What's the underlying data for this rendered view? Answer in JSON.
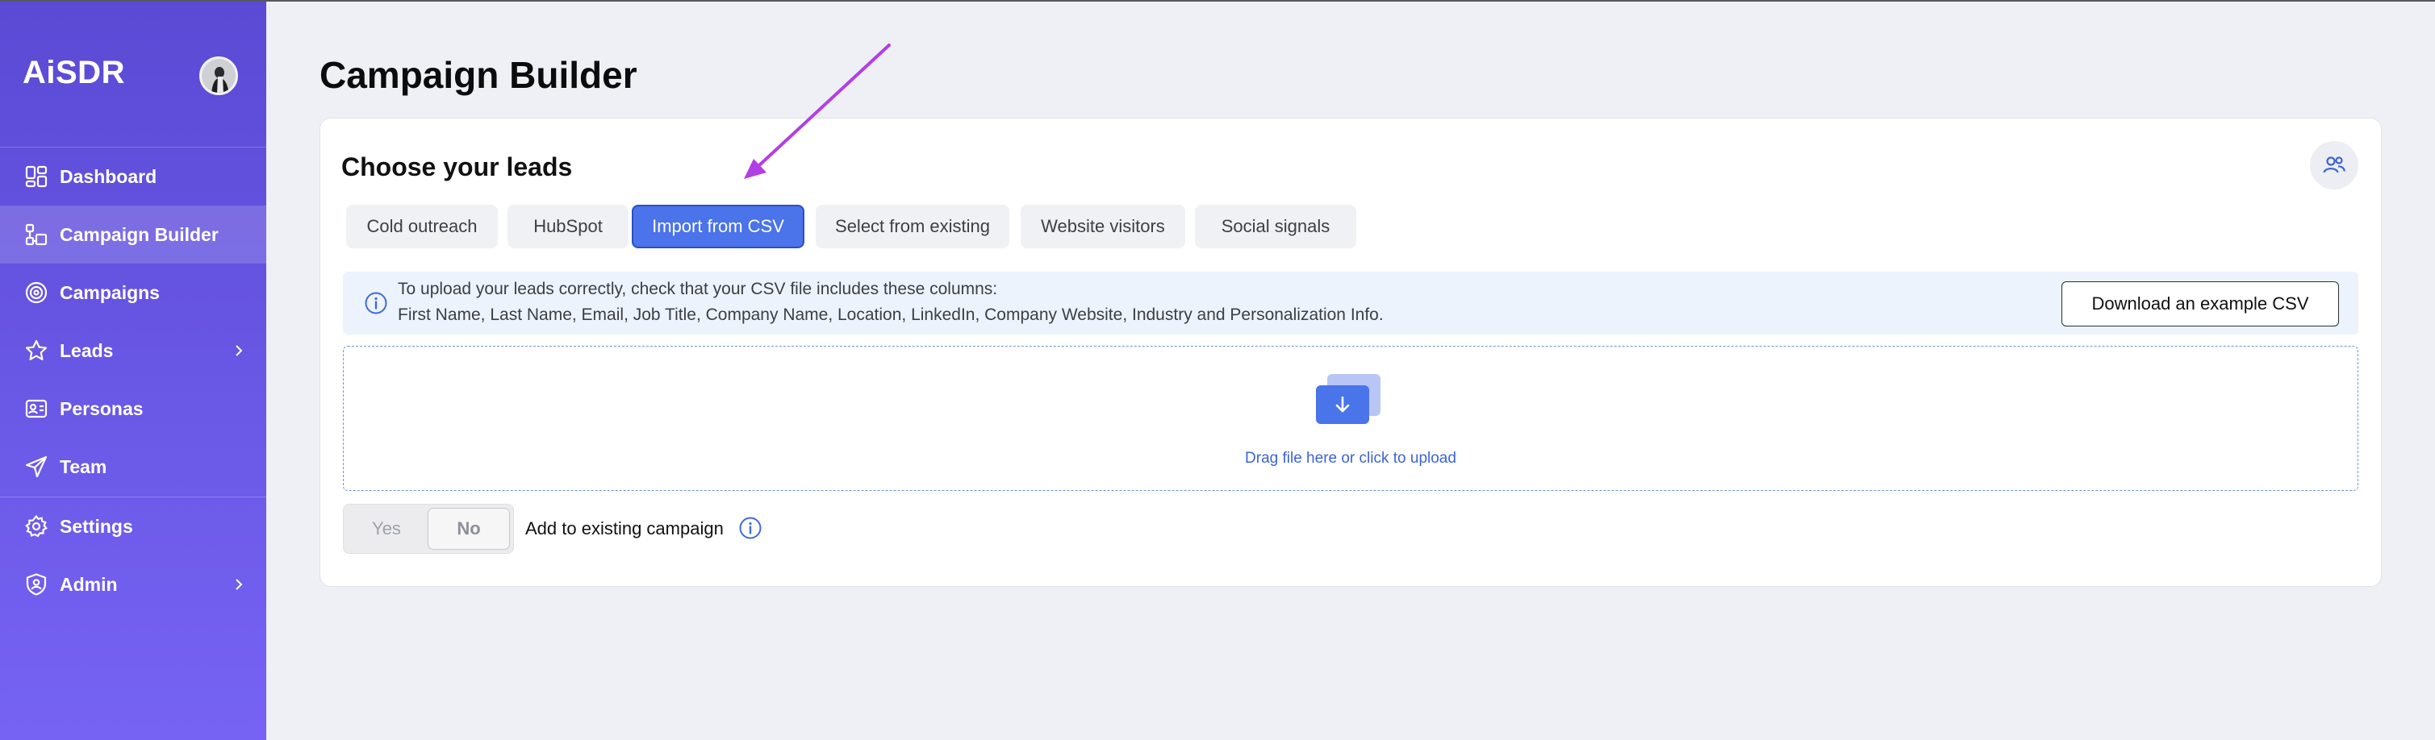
{
  "app": {
    "logo": "AiSDR"
  },
  "sidebar": {
    "items": [
      {
        "id": "dashboard",
        "label": "Dashboard",
        "icon": "dashboard-icon",
        "active": false,
        "has_chevron": false
      },
      {
        "id": "campaign-builder",
        "label": "Campaign Builder",
        "icon": "campaign-builder-icon",
        "active": true,
        "has_chevron": false
      },
      {
        "id": "campaigns",
        "label": "Campaigns",
        "icon": "target-icon",
        "active": false,
        "has_chevron": false
      },
      {
        "id": "leads",
        "label": "Leads",
        "icon": "star-icon",
        "active": false,
        "has_chevron": true
      },
      {
        "id": "personas",
        "label": "Personas",
        "icon": "persona-card-icon",
        "active": false,
        "has_chevron": false
      },
      {
        "id": "team",
        "label": "Team",
        "icon": "paper-plane-icon",
        "active": false,
        "has_chevron": false
      },
      {
        "id": "settings",
        "label": "Settings",
        "icon": "gear-icon",
        "active": false,
        "has_chevron": false
      },
      {
        "id": "admin",
        "label": "Admin",
        "icon": "shield-user-icon",
        "active": false,
        "has_chevron": true
      }
    ]
  },
  "main": {
    "title": "Campaign Builder",
    "card": {
      "title": "Choose your leads",
      "tabs": [
        {
          "label": "Cold outreach",
          "active": false
        },
        {
          "label": "HubSpot",
          "active": false
        },
        {
          "label": "Import from CSV",
          "active": true
        },
        {
          "label": "Select from existing",
          "active": false
        },
        {
          "label": "Website visitors",
          "active": false
        },
        {
          "label": "Social signals",
          "active": false
        }
      ],
      "info": {
        "line1": "To upload your leads correctly, check that your CSV file includes these columns:",
        "line2": "First Name, Last Name, Email, Job Title, Company Name, Location, LinkedIn, Company Website, Industry and Personalization Info.",
        "download_label": "Download an example CSV"
      },
      "dropzone": {
        "text": "Drag file here or click to upload"
      },
      "toggle": {
        "yes_label": "Yes",
        "no_label": "No",
        "selected": "No"
      },
      "add_existing_label": "Add to existing campaign"
    }
  },
  "colors": {
    "accent": "#4b73ea",
    "sidebar_top": "#5a4ad4",
    "sidebar_bottom": "#7663f4",
    "annotation_arrow": "#b23ee6"
  }
}
